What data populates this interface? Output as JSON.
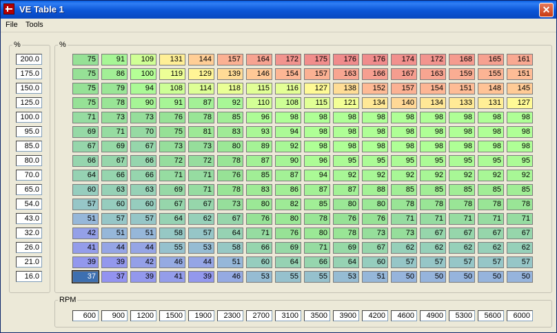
{
  "window": {
    "title": "VE Table 1",
    "close_symbol": "✕"
  },
  "menu": {
    "items": [
      "File",
      "Tools"
    ]
  },
  "y_axis": {
    "label": "%",
    "values": [
      "200.0",
      "175.0",
      "150.0",
      "125.0",
      "100.0",
      "95.0",
      "85.0",
      "80.0",
      "70.0",
      "65.0",
      "54.0",
      "43.0",
      "32.0",
      "26.0",
      "21.0",
      "16.0"
    ]
  },
  "table": {
    "label": "%",
    "rows": [
      [
        75,
        91,
        109,
        131,
        144,
        157,
        164,
        172,
        175,
        176,
        176,
        174,
        172,
        168,
        165,
        161
      ],
      [
        75,
        86,
        100,
        119,
        129,
        139,
        146,
        154,
        157,
        163,
        166,
        167,
        163,
        159,
        155,
        151
      ],
      [
        75,
        79,
        94,
        108,
        114,
        118,
        115,
        116,
        127,
        138,
        152,
        157,
        154,
        151,
        148,
        145
      ],
      [
        75,
        78,
        90,
        91,
        87,
        92,
        110,
        108,
        115,
        121,
        134,
        140,
        134,
        133,
        131,
        127
      ],
      [
        71,
        73,
        73,
        76,
        78,
        85,
        96,
        98,
        98,
        98,
        98,
        98,
        98,
        98,
        98,
        98
      ],
      [
        69,
        71,
        70,
        75,
        81,
        83,
        93,
        94,
        98,
        98,
        98,
        98,
        98,
        98,
        98,
        98
      ],
      [
        67,
        69,
        67,
        73,
        73,
        80,
        89,
        92,
        98,
        98,
        98,
        98,
        98,
        98,
        98,
        98
      ],
      [
        66,
        67,
        66,
        72,
        72,
        78,
        87,
        90,
        96,
        95,
        95,
        95,
        95,
        95,
        95,
        95
      ],
      [
        64,
        66,
        66,
        71,
        71,
        76,
        85,
        87,
        94,
        92,
        92,
        92,
        92,
        92,
        92,
        92
      ],
      [
        60,
        63,
        63,
        69,
        71,
        78,
        83,
        86,
        87,
        87,
        88,
        85,
        85,
        85,
        85,
        85
      ],
      [
        57,
        60,
        60,
        67,
        67,
        73,
        80,
        82,
        85,
        80,
        80,
        78,
        78,
        78,
        78,
        78
      ],
      [
        51,
        57,
        57,
        64,
        62,
        67,
        76,
        80,
        78,
        76,
        76,
        71,
        71,
        71,
        71,
        71
      ],
      [
        42,
        51,
        51,
        58,
        57,
        64,
        71,
        76,
        80,
        78,
        73,
        73,
        67,
        67,
        67,
        67
      ],
      [
        41,
        44,
        44,
        55,
        53,
        58,
        66,
        69,
        71,
        69,
        67,
        62,
        62,
        62,
        62,
        62
      ],
      [
        39,
        39,
        42,
        46,
        44,
        51,
        60,
        64,
        66,
        64,
        60,
        57,
        57,
        57,
        57,
        57
      ],
      [
        37,
        37,
        39,
        41,
        39,
        46,
        53,
        55,
        55,
        53,
        51,
        50,
        50,
        50,
        50,
        50
      ]
    ],
    "selected_cell": {
      "row": 15,
      "col": 0
    },
    "selected_color": "#3d6fb0"
  },
  "x_axis": {
    "label": "RPM",
    "values": [
      "600",
      "900",
      "1200",
      "1500",
      "1900",
      "2300",
      "2700",
      "3100",
      "3500",
      "3900",
      "4200",
      "4600",
      "4900",
      "5300",
      "5600",
      "6000"
    ]
  }
}
